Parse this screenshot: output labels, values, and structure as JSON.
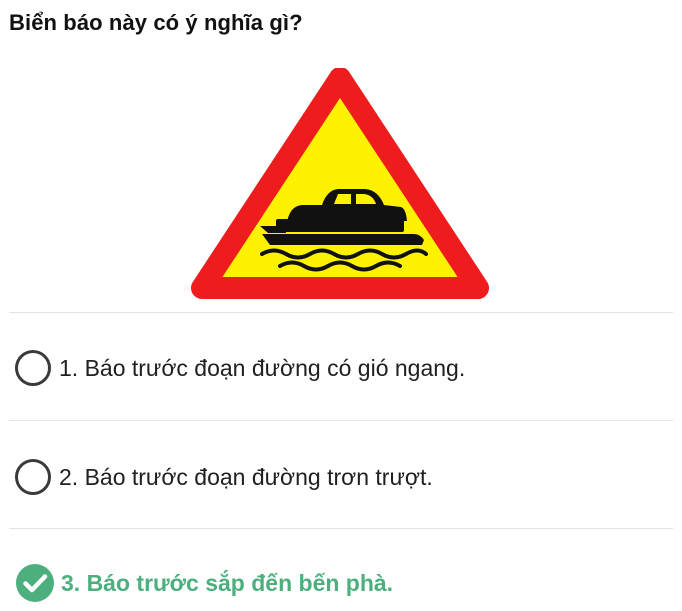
{
  "question": {
    "text": "Biển báo này có ý nghĩa gì?"
  },
  "sign": {
    "icon": "ferry-warning-sign-icon",
    "colors": {
      "border": "#ee1c1c",
      "fill": "#fff200",
      "symbol": "#111111"
    }
  },
  "options": [
    {
      "label": "1. Báo trước đoạn đường có gió ngang.",
      "state": "unselected"
    },
    {
      "label": "2. Báo trước đoạn đường trơn trượt.",
      "state": "unselected"
    },
    {
      "label": "3. Báo trước sắp đến bến phà.",
      "state": "correct"
    }
  ],
  "colors": {
    "correct": "#4caf7d",
    "radio_border": "#3a3a3a",
    "divider": "#e3e3e3"
  }
}
